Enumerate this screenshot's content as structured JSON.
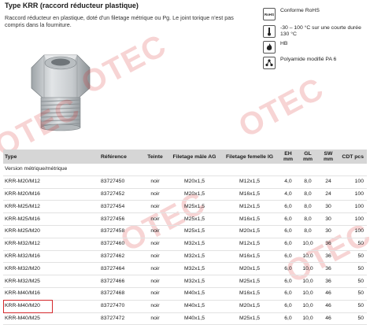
{
  "header": {
    "title": "Type KRR (raccord réducteur plastique)",
    "description": "Raccord réducteur en plastique, doté d'un filetage métrique ou Pg. Le joint torique n'est pas compris dans la fourniture."
  },
  "properties": [
    {
      "icon": "rohs-icon",
      "icon_text": "RoHS",
      "text": "Conforme RoHS"
    },
    {
      "icon": "thermometer-icon",
      "icon_text": "",
      "text": "-30 – 100 °C sur une courte durée 130 °C"
    },
    {
      "icon": "flame-icon",
      "icon_text": "",
      "text": "HB"
    },
    {
      "icon": "molecule-icon",
      "icon_text": "",
      "text": "Polyamide modifié PA 6"
    }
  ],
  "watermark": "OTEC",
  "table": {
    "headers": {
      "type": "Type",
      "reference": "Référence",
      "teinte": "Teinte",
      "filetage_male": "Filetage mâle AG",
      "filetage_femelle": "Filetage femelle IG",
      "eh": "EH mm",
      "gl": "GL mm",
      "sw": "SW mm",
      "cdt": "CDT pcs"
    },
    "section": "Version métrique/métrique",
    "rows": [
      {
        "type": "KRR-M20/M12",
        "ref": "83727450",
        "teinte": "noir",
        "male": "M20x1,5",
        "femelle": "M12x1,5",
        "eh": "4,0",
        "gl": "8,0",
        "sw": "24",
        "cdt": "100"
      },
      {
        "type": "KRR-M20/M16",
        "ref": "83727452",
        "teinte": "noir",
        "male": "M20x1,5",
        "femelle": "M16x1,5",
        "eh": "4,0",
        "gl": "8,0",
        "sw": "24",
        "cdt": "100"
      },
      {
        "type": "KRR-M25/M12",
        "ref": "83727454",
        "teinte": "noir",
        "male": "M25x1,5",
        "femelle": "M12x1,5",
        "eh": "6,0",
        "gl": "8,0",
        "sw": "30",
        "cdt": "100"
      },
      {
        "type": "KRR-M25/M16",
        "ref": "83727456",
        "teinte": "noir",
        "male": "M25x1,5",
        "femelle": "M16x1,5",
        "eh": "6,0",
        "gl": "8,0",
        "sw": "30",
        "cdt": "100"
      },
      {
        "type": "KRR-M25/M20",
        "ref": "83727458",
        "teinte": "noir",
        "male": "M25x1,5",
        "femelle": "M20x1,5",
        "eh": "6,0",
        "gl": "8,0",
        "sw": "30",
        "cdt": "100"
      },
      {
        "type": "KRR-M32/M12",
        "ref": "83727460",
        "teinte": "noir",
        "male": "M32x1,5",
        "femelle": "M12x1,5",
        "eh": "6,0",
        "gl": "10,0",
        "sw": "36",
        "cdt": "50"
      },
      {
        "type": "KRR-M32/M16",
        "ref": "83727462",
        "teinte": "noir",
        "male": "M32x1,5",
        "femelle": "M16x1,5",
        "eh": "6,0",
        "gl": "10,0",
        "sw": "36",
        "cdt": "50"
      },
      {
        "type": "KRR-M32/M20",
        "ref": "83727464",
        "teinte": "noir",
        "male": "M32x1,5",
        "femelle": "M20x1,5",
        "eh": "6,0",
        "gl": "10,0",
        "sw": "36",
        "cdt": "50"
      },
      {
        "type": "KRR-M32/M25",
        "ref": "83727466",
        "teinte": "noir",
        "male": "M32x1,5",
        "femelle": "M25x1,5",
        "eh": "6,0",
        "gl": "10,0",
        "sw": "36",
        "cdt": "50"
      },
      {
        "type": "KRR-M40/M16",
        "ref": "83727468",
        "teinte": "noir",
        "male": "M40x1,5",
        "femelle": "M16x1,5",
        "eh": "6,0",
        "gl": "10,0",
        "sw": "46",
        "cdt": "50"
      },
      {
        "type": "KRR-M40/M20",
        "ref": "83727470",
        "teinte": "noir",
        "male": "M40x1,5",
        "femelle": "M20x1,5",
        "eh": "6,0",
        "gl": "10,0",
        "sw": "46",
        "cdt": "50"
      },
      {
        "type": "KRR-M40/M25",
        "ref": "83727472",
        "teinte": "noir",
        "male": "M40x1,5",
        "femelle": "M25x1,5",
        "eh": "6,0",
        "gl": "10,0",
        "sw": "46",
        "cdt": "50"
      }
    ],
    "highlighted_row": "KRR-M40/M25"
  },
  "colors": {
    "header_bg": "#d6d6d6",
    "highlight": "#d4282b",
    "watermark": "#d72828"
  }
}
